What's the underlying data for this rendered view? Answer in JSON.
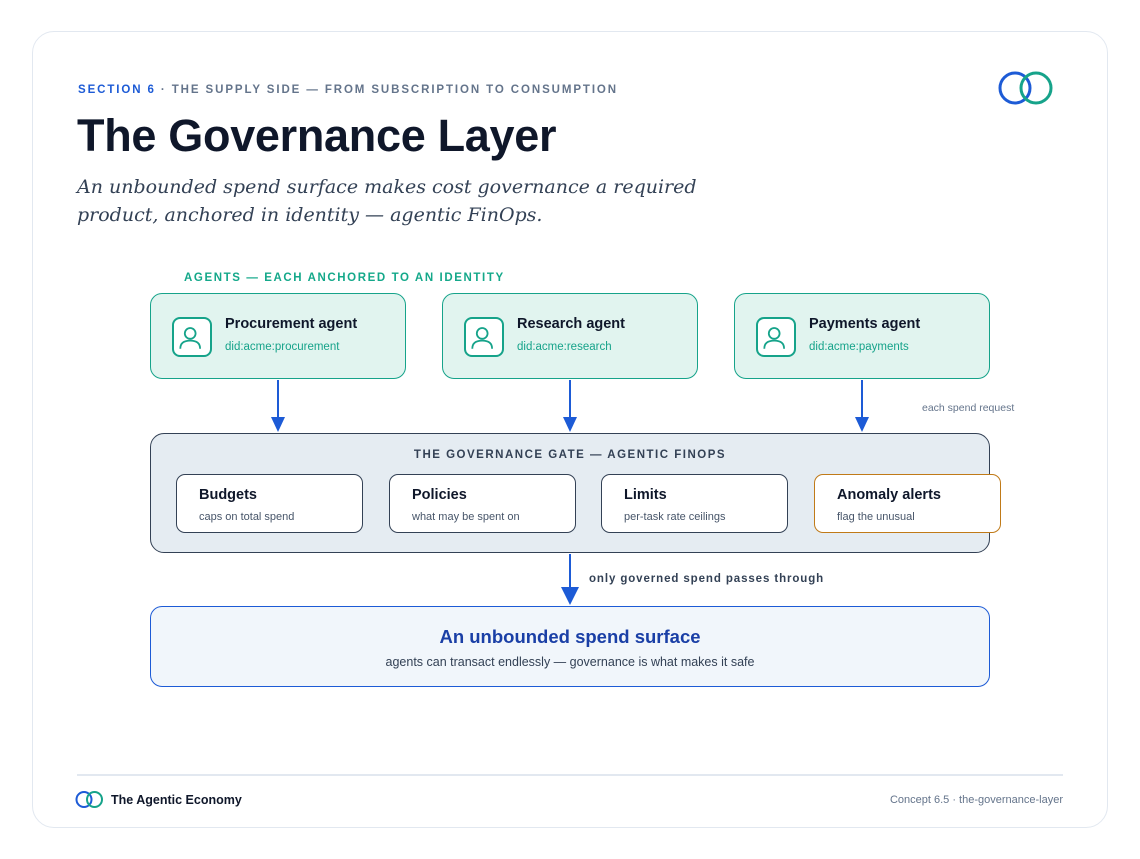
{
  "header": {
    "section_label": "SECTION 6",
    "section_context": "· THE SUPPLY SIDE — FROM SUBSCRIPTION TO CONSUMPTION",
    "title": "The Governance Layer",
    "subtitle": "An unbounded spend surface makes cost governance a required product, anchored in identity — agentic FinOps."
  },
  "agents": {
    "caption": "AGENTS — EACH ANCHORED TO AN IDENTITY",
    "items": [
      {
        "name": "Procurement agent",
        "did": "did:acme:procurement"
      },
      {
        "name": "Research agent",
        "did": "did:acme:research"
      },
      {
        "name": "Payments agent",
        "did": "did:acme:payments"
      }
    ],
    "request_note": "each spend request"
  },
  "gate": {
    "title": "THE GOVERNANCE GATE — AGENTIC FINOPS",
    "controls": [
      {
        "name": "Budgets",
        "desc": "caps on total spend"
      },
      {
        "name": "Policies",
        "desc": "what may be spent on"
      },
      {
        "name": "Limits",
        "desc": "per-task rate ceilings"
      },
      {
        "name": "Anomaly alerts",
        "desc": "flag the unusual"
      }
    ],
    "pass_note": "only governed spend passes through"
  },
  "surface": {
    "title": "An unbounded spend surface",
    "subtitle": "agents can transact endlessly — governance is what makes it safe"
  },
  "footer": {
    "brand": "The Agentic Economy",
    "concept": "Concept 6.5 · the-governance-layer"
  },
  "colors": {
    "accent_blue": "#1d5bd6",
    "accent_teal": "#16a38a",
    "alert_amber": "#c07a18",
    "ink": "#0f172a"
  },
  "icons": {
    "agent": "user-icon",
    "brand": "linked-rings-logo"
  }
}
